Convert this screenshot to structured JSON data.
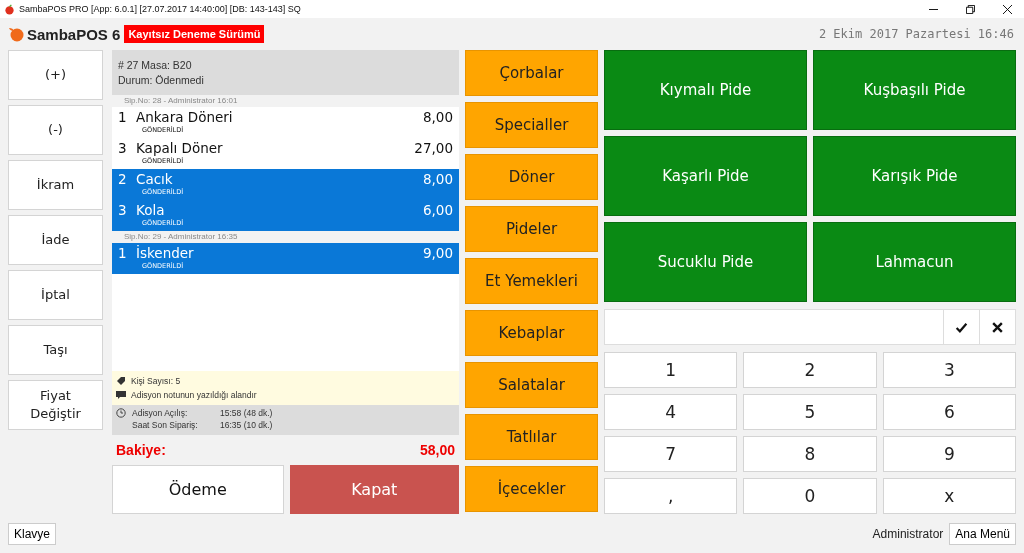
{
  "window": {
    "title": "SambaPOS PRO [App: 6.0.1] [27.07.2017 14:40:00] [DB: 143-143] SQ"
  },
  "header": {
    "logo": "SambaPOS 6",
    "badge": "Kayıtsız Deneme Sürümü",
    "date": "2 Ekim 2017 Pazartesi 16:46"
  },
  "actions": [
    "(+)",
    "(-)",
    "İkram",
    "İade",
    "İptal",
    "Taşı",
    "Fiyat Değiştir"
  ],
  "ticket": {
    "line_1": "# 27 Masa: B20",
    "line_2": "Durum: Ödenmedi",
    "groups": [
      {
        "header": "Sip.No: 28 - Administrator 16:01",
        "items": [
          {
            "qty": "1",
            "name": "Ankara Döneri",
            "price": "8,00",
            "status": "GÖNDERİLDİ",
            "selected": false
          },
          {
            "qty": "3",
            "name": "Kapalı Döner",
            "price": "27,00",
            "status": "GÖNDERİLDİ",
            "selected": false
          },
          {
            "qty": "2",
            "name": "Cacık",
            "price": "8,00",
            "status": "GÖNDERİLDİ",
            "selected": true
          },
          {
            "qty": "3",
            "name": "Kola",
            "price": "6,00",
            "status": "GÖNDERİLDİ",
            "selected": true
          }
        ]
      },
      {
        "header": "Sip.No: 29 - Administrator 16:35",
        "items": [
          {
            "qty": "1",
            "name": "İskender",
            "price": "9,00",
            "status": "GÖNDERİLDİ",
            "selected": true
          }
        ]
      }
    ],
    "guests": "Kişi Sayısı: 5",
    "note": "Adisyon notunun yazıldığı alandır",
    "times": [
      {
        "label": "Adisyon Açılış:",
        "value": "15:58 (48 dk.)"
      },
      {
        "label": "Saat Son Sipariş:",
        "value": "16:35 (10 dk.)"
      }
    ],
    "balance_label": "Bakiye:",
    "balance": "58,00",
    "pay_button": "Ödeme",
    "close_button": "Kapat"
  },
  "categories": [
    "Çorbalar",
    "Specialler",
    "Döner",
    "Pideler",
    "Et Yemekleri",
    "Kebaplar",
    "Salatalar",
    "Tatlılar",
    "İçecekler"
  ],
  "products": [
    "Kıymalı Pide",
    "Kuşbaşılı Pide",
    "Kaşarlı Pide",
    "Karışık Pide",
    "Sucuklu Pide",
    "Lahmacun"
  ],
  "keypad": [
    "1",
    "2",
    "3",
    "4",
    "5",
    "6",
    "7",
    "8",
    "9",
    ",",
    "0",
    "x"
  ],
  "footer": {
    "keyboard": "Klavye",
    "user": "Administrator",
    "menu": "Ana Menü"
  }
}
